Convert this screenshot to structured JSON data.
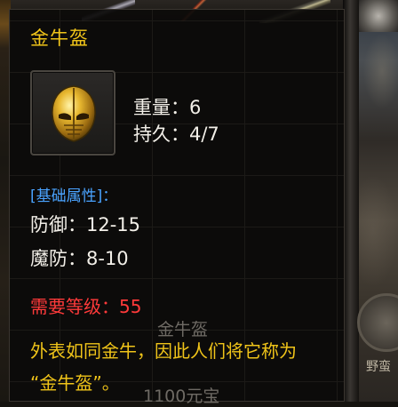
{
  "tooltip": {
    "item_name": "金牛盔",
    "icon": "golden-helmet-icon",
    "weight": "重量：6",
    "durability": "持久：4/7",
    "section_title": "[基础属性]：",
    "defense": "防御：12-15",
    "magic_defense": "魔防：8-10",
    "requirement": "需要等级：55",
    "description_line1": "外表如同金牛，因此人们将它称为",
    "description_line2": "“金牛盔”。"
  },
  "background": {
    "ghost_item_name": "金牛盔",
    "ghost_price": "1100元宝",
    "side_label": "野蛮"
  },
  "colors": {
    "title": "#f0c419",
    "section": "#4aa3ff",
    "requirement": "#ff3a3a",
    "stat_text": "#f2efe8"
  }
}
